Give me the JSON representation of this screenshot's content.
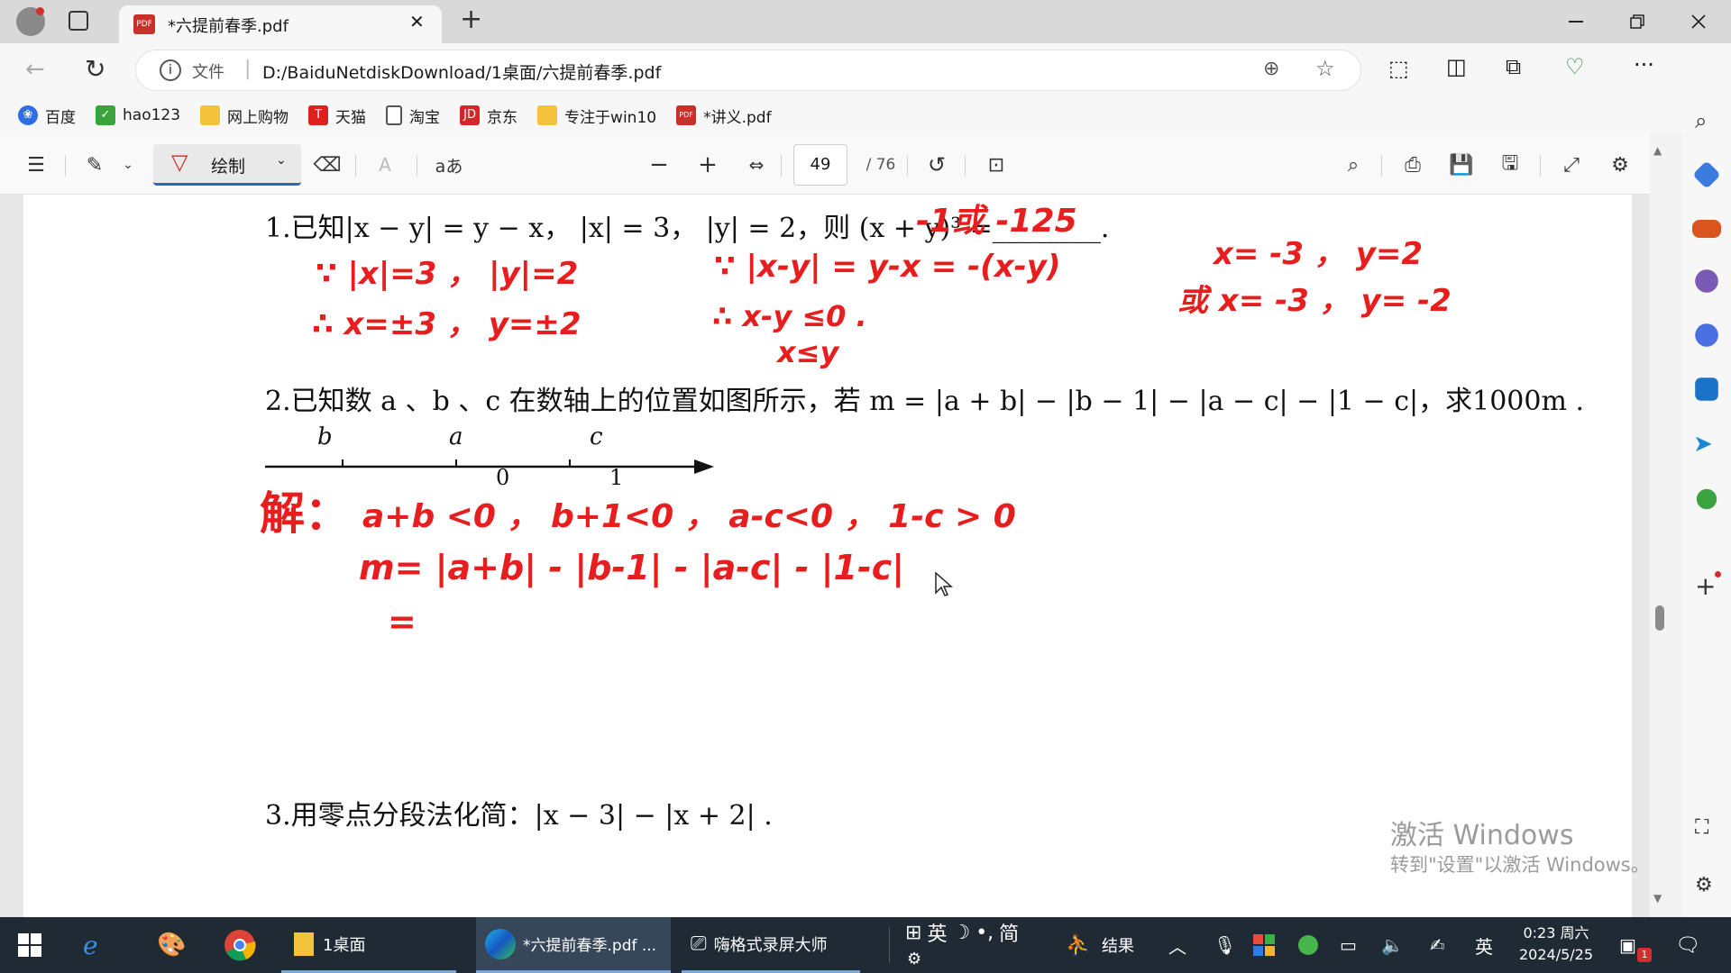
{
  "browser": {
    "tab_title": "*六提前春季.pdf",
    "address_scheme_label": "文件",
    "address_url": "D:/BaiduNetdiskDownload/1桌面/六提前春季.pdf",
    "favorites": [
      {
        "label": "百度",
        "icon": "baidu-icon",
        "color": "#2f6ee5"
      },
      {
        "label": "hao123",
        "icon": "hao123-icon",
        "color": "#38a43a"
      },
      {
        "label": "网上购物",
        "icon": "folder-icon",
        "color": "#f3c33c"
      },
      {
        "label": "天猫",
        "icon": "tmall-icon",
        "color": "#e0201c"
      },
      {
        "label": "淘宝",
        "icon": "page-icon",
        "color": "#555555"
      },
      {
        "label": "京东",
        "icon": "jd-icon",
        "color": "#d6252b"
      },
      {
        "label": "专注于win10",
        "icon": "folder-icon",
        "color": "#f3c33c"
      },
      {
        "label": "*讲义.pdf",
        "icon": "pdf-icon",
        "color": "#c9302c"
      }
    ]
  },
  "pdf_toolbar": {
    "draw_label": "绘制",
    "current_page": "49",
    "total_pages": "/ 76",
    "read_aloud_label": "aあ"
  },
  "document": {
    "q1_text": "1.已知|x − y| = y − x，  |x| = 3，  |y| = 2，则 (x + y)³ =________.",
    "q2_text": "2.已知数 a 、b 、c 在数轴上的位置如图所示，若 m = |a + b| − |b − 1| − |a − c| − |1 − c|，求1000m .",
    "q3_text": "3.用零点分段法化简：|x − 3| − |x + 2| .",
    "number_line_labels": {
      "b": "b",
      "a": "a",
      "c": "c",
      "zero": "0",
      "one": "1"
    }
  },
  "handwriting": {
    "q1_answer": "-1或 -125",
    "line1_left": "∵ |x|=3 ， |y|=2",
    "line2_left": "∴ x=±3 ， y=±2",
    "line1_mid": "∵ |x-y| = y-x = -(x-y)",
    "line2_mid": "∴ x-y ≤0 .",
    "line3_mid": "x≤y",
    "right1": "x= -3 ，  y=2",
    "right2": "或 x= -3 ， y= -2",
    "sol_label": "解：",
    "sol_line1": "a+b <0 ，  b+1<0 ，  a-c<0 ，  1-c > 0",
    "sol_line2": "m= |a+b| - |b-1| - |a-c| - |1-c|",
    "sol_line3": "="
  },
  "watermark": {
    "line1": "激活 Windows",
    "line2": "转到\"设置\"以激活 Windows。"
  },
  "taskbar": {
    "explorer_label": "1桌面",
    "edge_label": "*六提前春季.pdf ...",
    "recorder_label": "嗨格式录屏大师",
    "ime_label": "英",
    "ime_mode": "简",
    "news_label": "结果",
    "lang_label": "英",
    "time": "0:23 周六",
    "date": "2024/5/25",
    "notif_count": "1"
  }
}
